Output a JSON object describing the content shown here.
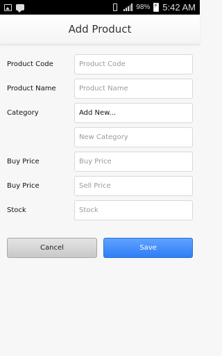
{
  "status_bar": {
    "battery_percent": "98%",
    "time": "5:42 AM"
  },
  "header": {
    "title": "Add Product"
  },
  "form": {
    "product_code": {
      "label": "Product Code",
      "placeholder": "Product Code",
      "value": ""
    },
    "product_name": {
      "label": "Product Name",
      "placeholder": "Product Name",
      "value": ""
    },
    "category": {
      "label": "Category",
      "selected": "Add New..."
    },
    "new_category": {
      "placeholder": "New Category",
      "value": ""
    },
    "buy_price": {
      "label": "Buy Price",
      "placeholder": "Buy Price",
      "value": ""
    },
    "sell_price": {
      "label": "Buy Price",
      "placeholder": "Sell Price",
      "value": ""
    },
    "stock": {
      "label": "Stock",
      "placeholder": "Stock",
      "value": ""
    }
  },
  "buttons": {
    "cancel_label": "Cancel",
    "save_label": "Save"
  },
  "colors": {
    "save_button": "#3d89fa",
    "cancel_button": "#d6d6d6",
    "background": "#f7f7f7"
  }
}
